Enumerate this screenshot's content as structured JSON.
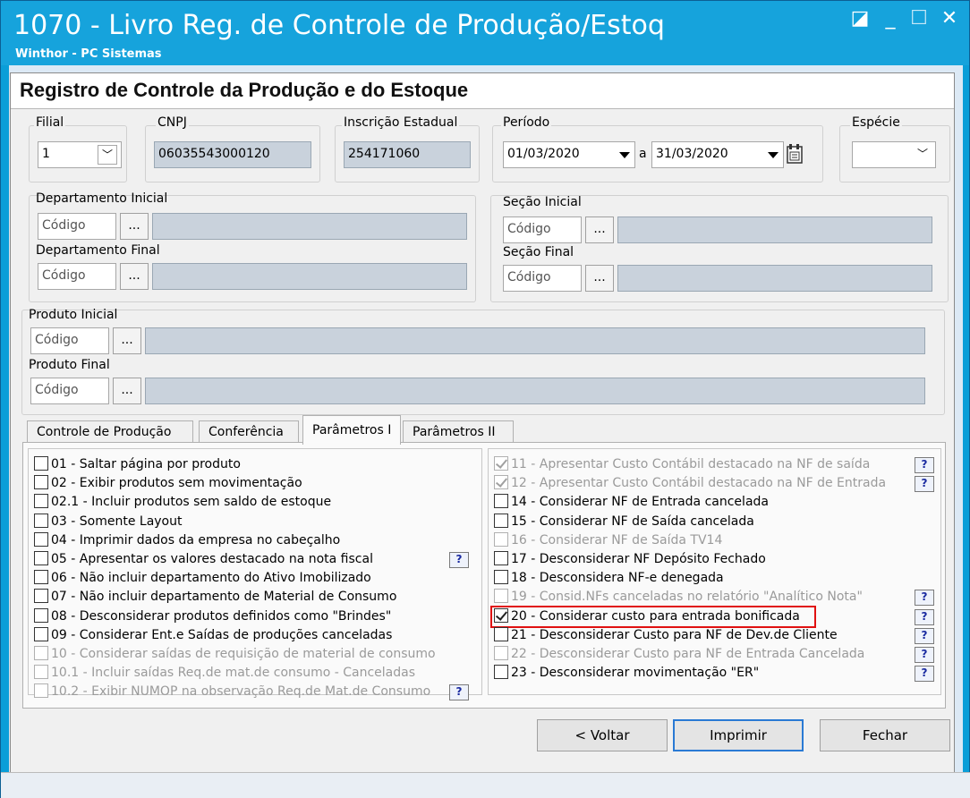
{
  "window": {
    "title": "1070 - Livro Reg. de Controle de Produção/Estoq",
    "subtitle": "Winthor - PC Sistemas",
    "restore_glyph": "◪",
    "minimize_glyph": "_",
    "maximize_glyph": "☐",
    "close_glyph": "✕"
  },
  "header": {
    "title": "Registro de Controle da Produção e do Estoque"
  },
  "filial": {
    "label": "Filial",
    "value": "1",
    "arrow": "﹀"
  },
  "cnpj": {
    "label": "CNPJ",
    "value": "06035543000120"
  },
  "ie": {
    "label": "Inscrição Estadual",
    "value": "254171060"
  },
  "periodo": {
    "label": "Período",
    "start": "01/03/2020",
    "sep": "a",
    "end": "31/03/2020"
  },
  "especie": {
    "label": "Espécie",
    "value": "",
    "arrow": "﹀"
  },
  "departamento": {
    "initial_label": "Departamento Inicial",
    "final_label": "Departamento Final",
    "placeholder": "Código"
  },
  "secao": {
    "initial_label": "Seção Inicial",
    "final_label": "Seção Final",
    "placeholder": "Código"
  },
  "produto": {
    "initial_label": "Produto Inicial",
    "final_label": "Produto Final",
    "placeholder": "Código"
  },
  "ellipsis": "...",
  "tabs": [
    {
      "label": "Controle de Produção"
    },
    {
      "label": "Conferência"
    },
    {
      "label": "Parâmetros I"
    },
    {
      "label": "Parâmetros II"
    }
  ],
  "help_glyph": "?",
  "left_options": [
    {
      "label": "01 - Saltar página por produto",
      "checked": false,
      "disabled": false
    },
    {
      "label": "02 - Exibir produtos sem movimentação",
      "checked": false,
      "disabled": false
    },
    {
      "label": "02.1 - Incluir produtos sem saldo de estoque",
      "checked": false,
      "disabled": false
    },
    {
      "label": "03 - Somente Layout",
      "checked": false,
      "disabled": false
    },
    {
      "label": "04 - Imprimir dados da empresa no cabeçalho",
      "checked": false,
      "disabled": false
    },
    {
      "label": "05 - Apresentar os valores destacado na nota fiscal",
      "checked": false,
      "disabled": false,
      "help": true
    },
    {
      "label": "06 - Não incluir departamento do Ativo Imobilizado",
      "checked": false,
      "disabled": false
    },
    {
      "label": "07 - Não incluir departamento de Material de Consumo",
      "checked": false,
      "disabled": false
    },
    {
      "label": "08 - Desconsiderar produtos definidos como \"Brindes\"",
      "checked": false,
      "disabled": false
    },
    {
      "label": "09 - Considerar Ent.e Saídas de produções canceladas",
      "checked": false,
      "disabled": false
    },
    {
      "label": "10 - Considerar saídas de requisição de material de consumo",
      "checked": false,
      "disabled": true
    },
    {
      "label": "10.1 - Incluir saídas Req.de mat.de consumo - Canceladas",
      "checked": false,
      "disabled": true
    },
    {
      "label": "10.2 - Exibir NUMOP na observação Req.de Mat.de Consumo",
      "checked": false,
      "disabled": true,
      "help": true
    }
  ],
  "right_options": [
    {
      "label": "11 - Apresentar Custo Contábil destacado na NF de saída",
      "checked": true,
      "disabled": true,
      "help": true
    },
    {
      "label": "12 - Apresentar Custo Contábil destacado na NF de Entrada",
      "checked": true,
      "disabled": true,
      "help": true
    },
    {
      "label": "14 - Considerar NF de Entrada cancelada",
      "checked": false,
      "disabled": false
    },
    {
      "label": "15 - Considerar NF de Saída cancelada",
      "checked": false,
      "disabled": false
    },
    {
      "label": "16 - Considerar NF de Saída TV14",
      "checked": false,
      "disabled": true
    },
    {
      "label": "17 - Desconsiderar NF Depósito Fechado",
      "checked": false,
      "disabled": false
    },
    {
      "label": "18 - Desconsidera NF-e denegada",
      "checked": false,
      "disabled": false
    },
    {
      "label": "19 - Consid.NFs canceladas no relatório \"Analítico Nota\"",
      "checked": false,
      "disabled": true,
      "help": true
    },
    {
      "label": "20 - Considerar custo para entrada bonificada",
      "checked": true,
      "disabled": false,
      "help": true,
      "highlighted": true
    },
    {
      "label": "21 - Desconsiderar Custo para NF de Dev.de Cliente",
      "checked": false,
      "disabled": false,
      "help": true
    },
    {
      "label": "22 - Desconsiderar Custo para NF de Entrada Cancelada",
      "checked": false,
      "disabled": true,
      "help": true
    },
    {
      "label": "23 - Desconsiderar movimentação \"ER\"",
      "checked": false,
      "disabled": false,
      "help": true
    }
  ],
  "buttons": {
    "back": "< Voltar",
    "print": "Imprimir",
    "close": "Fechar"
  },
  "colors": {
    "title_bar": "#16a3dc",
    "highlight": "#e01010",
    "readonly_field": "#c9d2dc"
  }
}
